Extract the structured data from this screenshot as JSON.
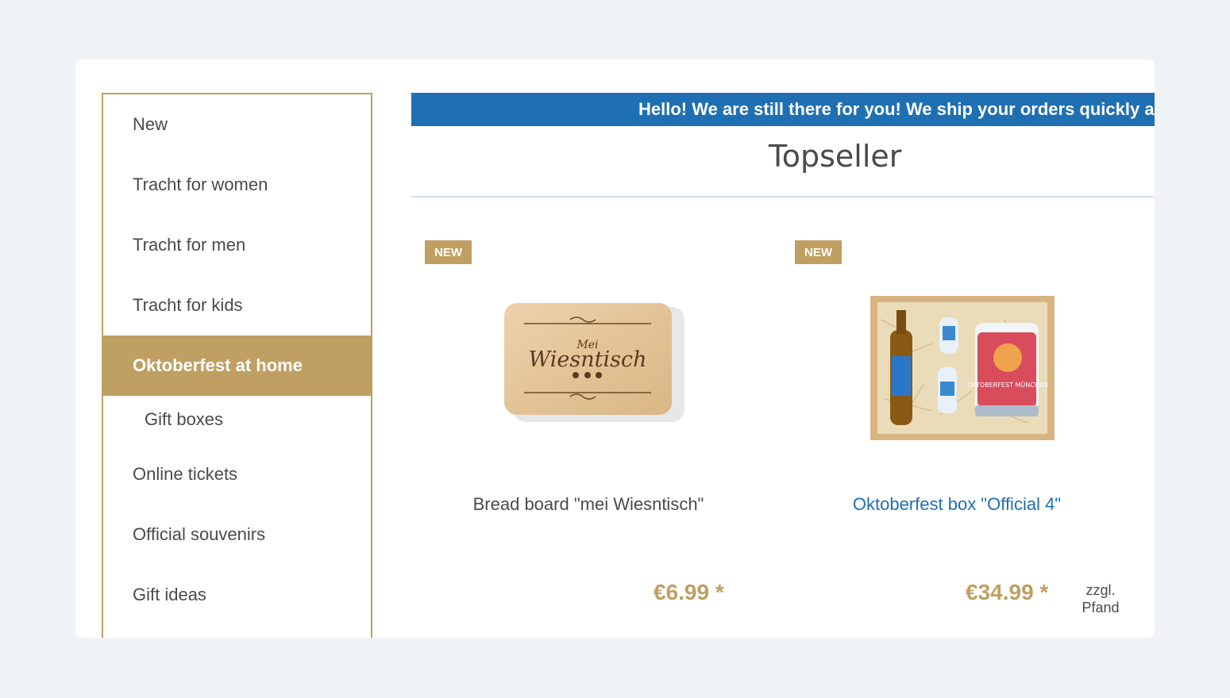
{
  "sidebar": {
    "items": [
      {
        "label": "New"
      },
      {
        "label": "Tracht for women"
      },
      {
        "label": "Tracht for men"
      },
      {
        "label": "Tracht for kids"
      },
      {
        "label": "Oktoberfest at home"
      },
      {
        "label": "Gift boxes"
      },
      {
        "label": "Online tickets"
      },
      {
        "label": "Official souvenirs"
      },
      {
        "label": "Gift ideas"
      }
    ]
  },
  "banner": {
    "text": "Hello! We are still there for you! We ship your orders quickly and re"
  },
  "section": {
    "title": "Topseller"
  },
  "products": [
    {
      "badge": "NEW",
      "name": "Bread board \"mei Wiesntisch\"",
      "price": "€6.99 *",
      "deposit": ""
    },
    {
      "badge": "NEW",
      "name": "Oktoberfest box \"Official 4\"",
      "price": "€34.99 *",
      "deposit": "zzgl. Pfand"
    }
  ],
  "images": {
    "board_text_top": "Mei",
    "board_text_main": "Wiesntisch",
    "stein_text": "OKTOBERFEST MÜNCHEN"
  },
  "colors": {
    "accent": "#bf9f62",
    "banner": "#1f6fb3",
    "link": "#1f6fb3",
    "background": "#f0f3f6"
  }
}
